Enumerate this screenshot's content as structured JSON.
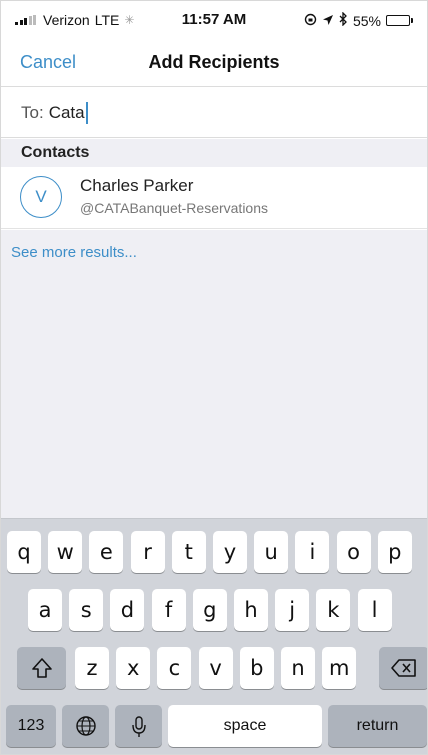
{
  "status_bar": {
    "carrier": "Verizon",
    "network": "LTE",
    "time": "11:57 AM",
    "battery_percent": "55%",
    "battery_level": 0.55
  },
  "nav": {
    "cancel_label": "Cancel",
    "title": "Add Recipients"
  },
  "to_field": {
    "label": "To:",
    "value": "Cata"
  },
  "section": {
    "header": "Contacts"
  },
  "contact": {
    "initial": "V",
    "name": "Charles Parker",
    "handle": "@CATABanquet-Reservations"
  },
  "see_more_label": "See more results...",
  "keyboard": {
    "row1": [
      "q",
      "w",
      "e",
      "r",
      "t",
      "y",
      "u",
      "i",
      "o",
      "p"
    ],
    "row2": [
      "a",
      "s",
      "d",
      "f",
      "g",
      "h",
      "j",
      "k",
      "l"
    ],
    "row3": [
      "z",
      "x",
      "c",
      "v",
      "b",
      "n",
      "m"
    ],
    "numbers_label": "123",
    "space_label": "space",
    "return_label": "return"
  },
  "colors": {
    "accent": "#3d8ec8",
    "keyboard_bg": "#d1d4da",
    "section_bg": "#efeff4"
  }
}
